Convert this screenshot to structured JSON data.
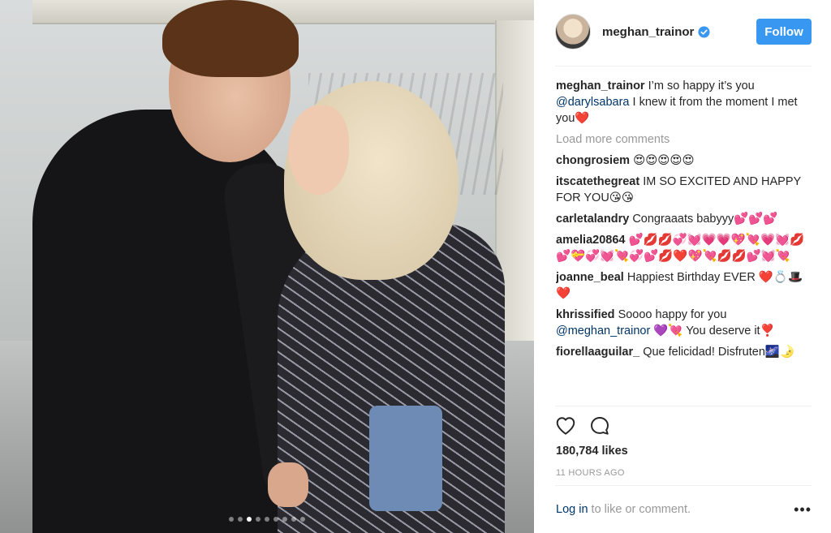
{
  "post": {
    "username": "meghan_trainor",
    "verified": true,
    "follow_label": "Follow",
    "caption_user": "meghan_trainor",
    "caption_text_1": "I’m so happy it’s you",
    "caption_mention": "@darylsabara",
    "caption_text_2": "I knew it from the moment I met you",
    "caption_emoji": "❤️",
    "load_more": "Load more comments",
    "likes": "180,784 likes",
    "time": "11 HOURS AGO",
    "login_link": "Log in",
    "login_text": "to like or comment.",
    "more_label": "•••"
  },
  "comments": [
    {
      "user": "chongrosiem",
      "text": "",
      "emoji": "😍😍😍😍😍"
    },
    {
      "user": "itscatethegreat",
      "text": "IM SO EXCITED AND HAPPY FOR YOU",
      "emoji": "😘😘"
    },
    {
      "user": "carletalandry",
      "text": "Congraaats babyyy",
      "emoji": "💕💕💕"
    },
    {
      "user": "amelia20864",
      "text": "",
      "emoji": "💕💋💋💞💓💗💗💖💘💗💓💋💕💝💞💓💘💞💕💋❤️💖💘💋💋💕💓💘"
    },
    {
      "user": "joanne_beal",
      "text": "Happiest Birthday EVER",
      "emoji": "❤️💍🎩❤️"
    },
    {
      "user": "khrissified",
      "text": "Soooo happy for you",
      "mention": "@meghan_trainor",
      "emoji": "💜💘",
      "text_after": "You deserve it",
      "emoji_after": "❣️"
    },
    {
      "user": "fiorellaaguilar_",
      "text": "Que felicidad! Disfruten",
      "emoji": "🌌🌛"
    }
  ],
  "carousel": {
    "count": 9,
    "active_index": 2
  },
  "colors": {
    "follow_bg": "#3897f0",
    "link": "#003569",
    "muted": "#999999",
    "text": "#262626",
    "verified": "#3897f0"
  },
  "icons": [
    "verified-badge-icon",
    "heart-icon",
    "comment-icon",
    "more-options-icon"
  ]
}
